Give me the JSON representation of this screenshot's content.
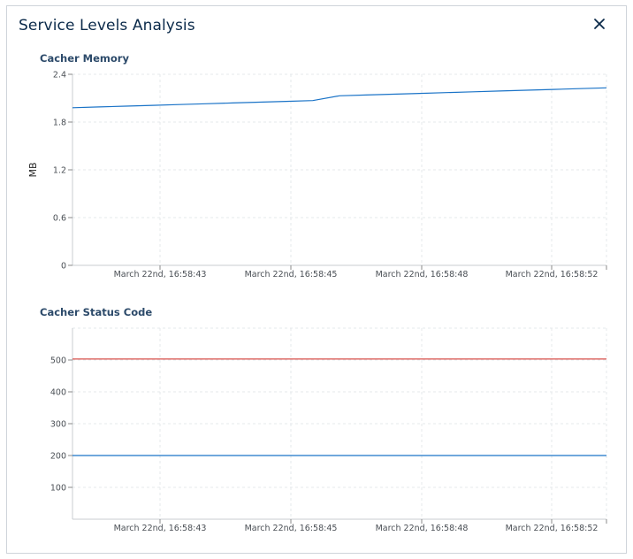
{
  "modal": {
    "title": "Service Levels Analysis",
    "close_icon": "close-icon"
  },
  "chart_data": [
    {
      "type": "line",
      "title": "Cacher Memory",
      "ylabel": "MB",
      "xlabel": "",
      "ylim": [
        0,
        2.4
      ],
      "yticks": [
        0,
        0.6,
        1.2,
        1.8,
        2.4
      ],
      "ytick_labels": [
        "0",
        "0.6",
        "1.2",
        "1.8",
        "2.4"
      ],
      "xtick_labels": [
        "March 22nd, 16:58:43",
        "March 22nd, 16:58:45",
        "March 22nd, 16:58:48",
        "March 22nd, 16:58:52"
      ],
      "grid": true,
      "series": [
        {
          "color": "#1a73c7",
          "values": [
            1.98,
            1.99,
            2.0,
            2.01,
            2.02,
            2.03,
            2.04,
            2.05,
            2.06,
            2.07,
            2.13,
            2.14,
            2.15,
            2.16,
            2.17,
            2.18,
            2.19,
            2.2,
            2.21,
            2.22,
            2.23
          ]
        }
      ]
    },
    {
      "type": "line",
      "title": "Cacher Status Code",
      "ylabel": "",
      "xlabel": "",
      "ylim": [
        0,
        600
      ],
      "yticks": [
        100,
        200,
        300,
        400,
        500
      ],
      "ytick_labels": [
        "100",
        "200",
        "300",
        "400",
        "500"
      ],
      "xtick_labels": [
        "March 22nd, 16:58:43",
        "March 22nd, 16:58:45",
        "March 22nd, 16:58:48",
        "March 22nd, 16:58:52"
      ],
      "grid": true,
      "series": [
        {
          "color": "#d9534f",
          "values": [
            503,
            503,
            503,
            503,
            503,
            503,
            503,
            503,
            503,
            503,
            503
          ]
        },
        {
          "color": "#1a73c7",
          "values": [
            200,
            200,
            200,
            200,
            200,
            200,
            200,
            200,
            200,
            200,
            200
          ]
        }
      ]
    }
  ]
}
